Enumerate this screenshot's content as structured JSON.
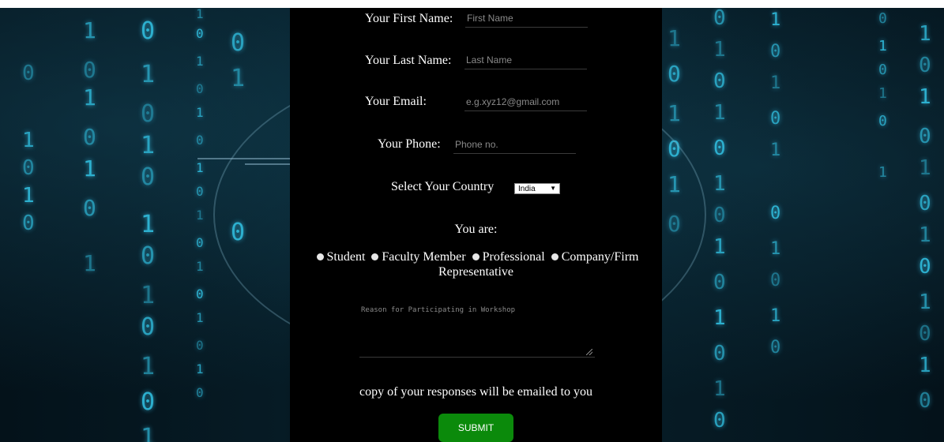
{
  "form": {
    "first_name": {
      "label": "Your First Name:",
      "placeholder": "First Name",
      "value": ""
    },
    "last_name": {
      "label": "Your Last Name:",
      "placeholder": "Last Name",
      "value": ""
    },
    "email": {
      "label": "Your Email:",
      "placeholder": "e.g.xyz12@gmail.com",
      "value": ""
    },
    "phone": {
      "label": "Your Phone:",
      "placeholder": "Phone no.",
      "value": ""
    },
    "country": {
      "label": "Select Your Country",
      "selected": "India"
    },
    "role": {
      "label": "You are:",
      "options": [
        "Student",
        "Faculty Member",
        "Professional",
        "Company/Firm Representative"
      ]
    },
    "reason": {
      "placeholder": "Reason for Participating in Workshop",
      "value": ""
    },
    "note": "copy of your responses will be emailed to you",
    "submit_label": "SUBMIT"
  },
  "background": {
    "digits": [
      "0",
      "1"
    ],
    "accent_color": "#2fb8d8",
    "panel_color": "#000000",
    "button_color": "#0b8a0b"
  }
}
